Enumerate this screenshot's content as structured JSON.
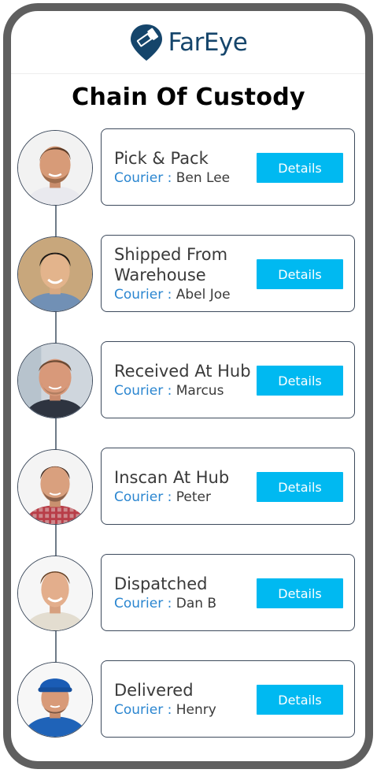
{
  "header": {
    "brand_name": "FarEye",
    "brand_color": "#15456b"
  },
  "page_title": "Chain Of Custody",
  "colors": {
    "accent_button": "#00b9f1",
    "courier_label": "#2b86d0",
    "text": "#3a3a3a",
    "frame": "#5f5f5f"
  },
  "steps": [
    {
      "title": "Pick & Pack",
      "courier_label": "Courier :",
      "courier_name": "Ben Lee",
      "button_label": "Details",
      "avatar": "avatar-photo-ben-lee"
    },
    {
      "title": "Shipped From Warehouse",
      "courier_label": "Courier :",
      "courier_name": "Abel Joe",
      "button_label": "Details",
      "avatar": "avatar-photo-abel-joe"
    },
    {
      "title": "Received At Hub",
      "courier_label": "Courier :",
      "courier_name": "Marcus",
      "button_label": "Details",
      "avatar": "avatar-photo-marcus"
    },
    {
      "title": "Inscan At Hub",
      "courier_label": "Courier :",
      "courier_name": "Peter",
      "button_label": "Details",
      "avatar": "avatar-photo-peter"
    },
    {
      "title": "Dispatched",
      "courier_label": "Courier :",
      "courier_name": "Dan B",
      "button_label": "Details",
      "avatar": "avatar-photo-dan-b"
    },
    {
      "title": "Delivered",
      "courier_label": "Courier :",
      "courier_name": "Henry",
      "button_label": "Details",
      "avatar": "avatar-photo-henry"
    }
  ]
}
